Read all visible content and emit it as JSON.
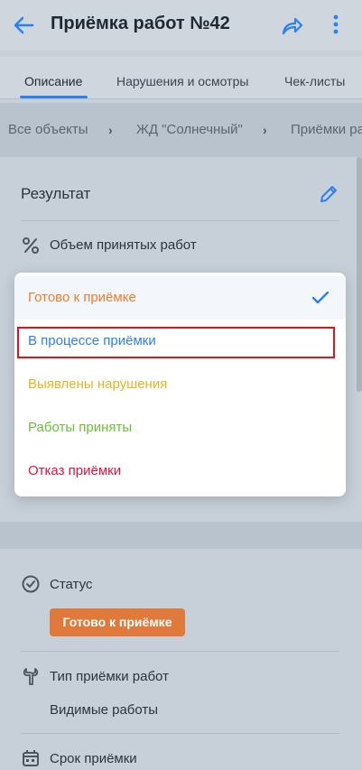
{
  "header": {
    "title": "Приёмка работ №42"
  },
  "tabs": [
    {
      "label": "Описание",
      "active": true
    },
    {
      "label": "Нарушения и осмотры",
      "active": false
    },
    {
      "label": "Чек-листы",
      "active": false
    }
  ],
  "breadcrumbs": [
    "Все объекты",
    "ЖД \"Солнечный\"",
    "Приёмки ра"
  ],
  "result_section": {
    "title": "Результат",
    "volume_label": "Объем принятых работ"
  },
  "dropdown": {
    "options": [
      {
        "label": "Готово к приёмке",
        "color": "#f07c2e",
        "selected": true
      },
      {
        "label": "В процессе приёмки",
        "color": "#2f80ed",
        "selected": false
      },
      {
        "label": "Выявлены нарушения",
        "color": "#e6b422",
        "selected": false
      },
      {
        "label": "Работы приняты",
        "color": "#6abf3a",
        "selected": false
      },
      {
        "label": "Отказ приёмки",
        "color": "#e0143c",
        "selected": false
      }
    ]
  },
  "status": {
    "label": "Статус",
    "value": "Готово к приёмке",
    "badge_color": "#e07a3c"
  },
  "work_type": {
    "label": "Тип приёмки работ",
    "value": "Видимые работы"
  },
  "deadline": {
    "label": "Срок приёмки"
  },
  "colors": {
    "accent": "#2f80ed",
    "highlight_border": "#e0141a"
  }
}
